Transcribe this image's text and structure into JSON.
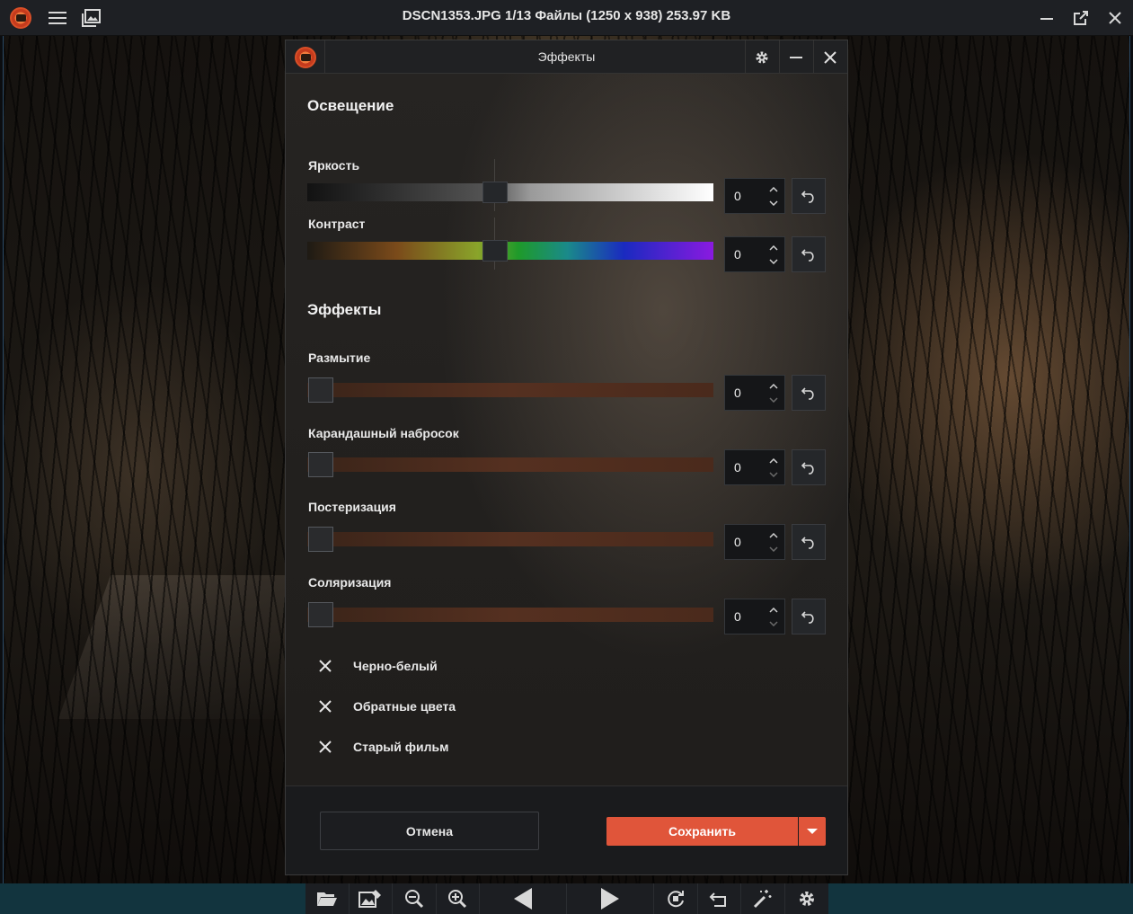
{
  "window": {
    "title": "DSCN1353.JPG 1/13 Файлы (1250 x 938) 253.97 KB",
    "icons": [
      "app-logo",
      "menu-icon",
      "gallery-icon",
      "minimize-icon",
      "open-external-icon",
      "close-icon"
    ]
  },
  "dialog": {
    "title": "Эффекты",
    "header_icons": [
      "settings-icon",
      "minimize-icon",
      "close-icon"
    ],
    "sections": {
      "lighting_title": "Освещение",
      "effects_title": "Эффекты"
    },
    "sliders": {
      "brightness": {
        "label": "Яркость",
        "value": "0",
        "position": 0.5
      },
      "contrast": {
        "label": "Контраст",
        "value": "0",
        "position": 0.5
      },
      "blur": {
        "label": "Размытие",
        "value": "0",
        "position": 0
      },
      "pencil": {
        "label": "Карандашный набросок",
        "value": "0",
        "position": 0
      },
      "posterize": {
        "label": "Постеризация",
        "value": "0",
        "position": 0
      },
      "solarize": {
        "label": "Соляризация",
        "value": "0",
        "position": 0
      }
    },
    "toggles": [
      {
        "label": "Черно-белый",
        "checked": false
      },
      {
        "label": "Обратные цвета",
        "checked": false
      },
      {
        "label": "Старый фильм",
        "checked": false
      }
    ],
    "buttons": {
      "cancel": "Отмена",
      "save": "Сохранить"
    },
    "colors": {
      "accent": "#e0553a"
    }
  },
  "toolbar": {
    "icons": [
      "open-folder-icon",
      "image-edit-icon",
      "zoom-out-icon",
      "zoom-in-icon",
      "previous-icon",
      "next-icon",
      "rotate-icon",
      "undo-icon",
      "magic-wand-icon",
      "settings-icon"
    ]
  }
}
